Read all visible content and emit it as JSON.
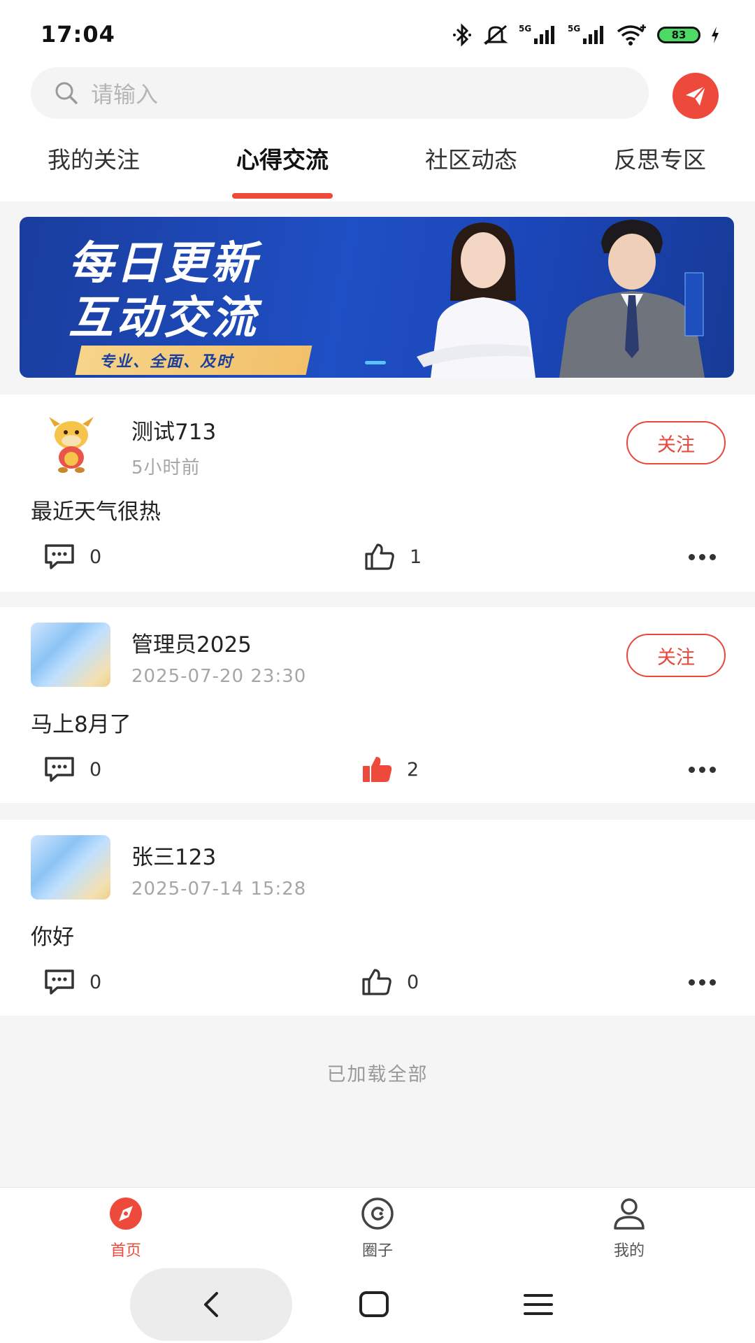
{
  "status_bar": {
    "time": "17:04",
    "battery": "83",
    "icons": [
      "bluetooth-icon",
      "mute-icon",
      "signal-5g-icon",
      "signal-5g-icon",
      "wifi-icon",
      "battery-icon",
      "charging-icon"
    ]
  },
  "search": {
    "placeholder": "请输入",
    "icon": "search-icon",
    "send_icon": "send-icon",
    "accent_color": "#ee4a3c"
  },
  "tabs": [
    {
      "label": "我的关注",
      "active": false
    },
    {
      "label": "心得交流",
      "active": true
    },
    {
      "label": "社区动态",
      "active": false
    },
    {
      "label": "反思专区",
      "active": false
    }
  ],
  "banner": {
    "title_line1": "每日更新",
    "title_line2": "互动交流",
    "tag": "专业、全面、及时"
  },
  "posts": [
    {
      "username": "测试713",
      "time": "5小时前",
      "content": "最近天气很热",
      "follow_label": "关注",
      "comments": "0",
      "likes": "1",
      "liked": false,
      "avatar": "cow-mascot"
    },
    {
      "username": "管理员2025",
      "time": "2025-07-20 23:30",
      "content": "马上8月了",
      "follow_label": "关注",
      "comments": "0",
      "likes": "2",
      "liked": true,
      "avatar": "gradient"
    },
    {
      "username": "张三123",
      "time": "2025-07-14 15:28",
      "content": "你好",
      "comments": "0",
      "likes": "0",
      "liked": false,
      "avatar": "gradient"
    }
  ],
  "footer": {
    "loaded_all": "已加载全部"
  },
  "bottom_nav": [
    {
      "label": "首页",
      "icon": "compass-icon",
      "active": true
    },
    {
      "label": "圈子",
      "icon": "circle-icon",
      "active": false
    },
    {
      "label": "我的",
      "icon": "user-icon",
      "active": false
    }
  ]
}
